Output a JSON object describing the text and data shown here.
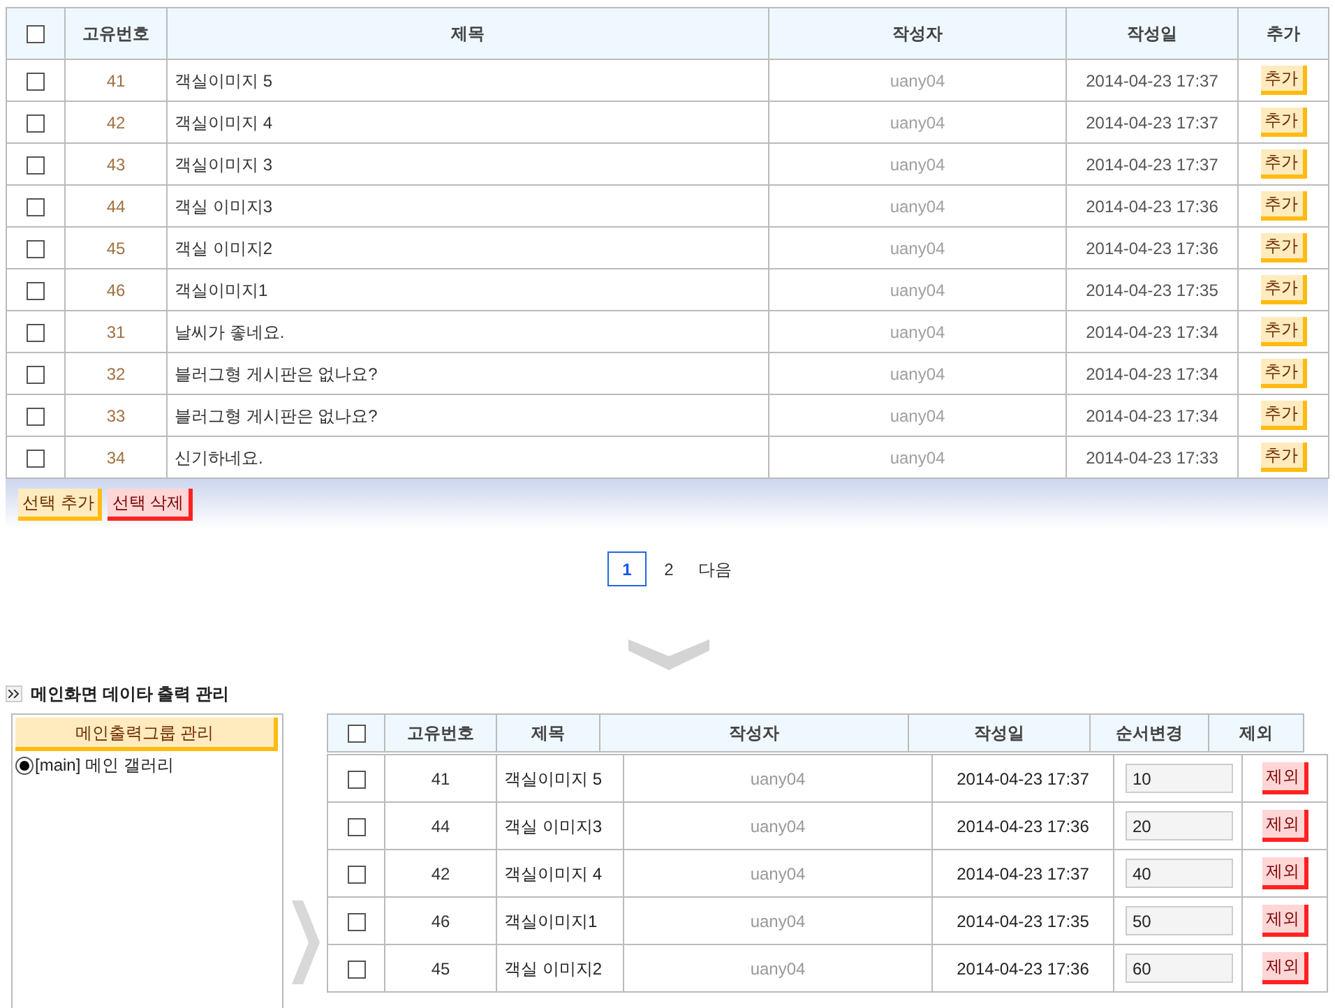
{
  "list_table": {
    "columns": [
      "고유번호",
      "제목",
      "작성자",
      "작성일",
      "추가"
    ],
    "header_checked": false,
    "rows": [
      {
        "checked": false,
        "id": "41",
        "title": "객실이미지 5",
        "author": "uany04",
        "date": "2014-04-23 17:37",
        "button": "추가"
      },
      {
        "checked": false,
        "id": "42",
        "title": "객실이미지 4",
        "author": "uany04",
        "date": "2014-04-23 17:37",
        "button": "추가"
      },
      {
        "checked": false,
        "id": "43",
        "title": "객실이미지 3",
        "author": "uany04",
        "date": "2014-04-23 17:37",
        "button": "추가"
      },
      {
        "checked": false,
        "id": "44",
        "title": "객실 이미지3",
        "author": "uany04",
        "date": "2014-04-23 17:36",
        "button": "추가"
      },
      {
        "checked": false,
        "id": "45",
        "title": "객실 이미지2",
        "author": "uany04",
        "date": "2014-04-23 17:36",
        "button": "추가"
      },
      {
        "checked": false,
        "id": "46",
        "title": "객실이미지1",
        "author": "uany04",
        "date": "2014-04-23 17:35",
        "button": "추가"
      },
      {
        "checked": false,
        "id": "31",
        "title": "날씨가 좋네요.",
        "author": "uany04",
        "date": "2014-04-23 17:34",
        "button": "추가"
      },
      {
        "checked": false,
        "id": "32",
        "title": "블러그형 게시판은 없나요?",
        "author": "uany04",
        "date": "2014-04-23 17:34",
        "button": "추가"
      },
      {
        "checked": false,
        "id": "33",
        "title": "블러그형 게시판은 없나요?",
        "author": "uany04",
        "date": "2014-04-23 17:34",
        "button": "추가"
      },
      {
        "checked": false,
        "id": "34",
        "title": "신기하네요.",
        "author": "uany04",
        "date": "2014-04-23 17:33",
        "button": "추가"
      }
    ],
    "actions": [
      {
        "label": "선택 추가",
        "kind": "add"
      },
      {
        "label": "선택 삭제",
        "kind": "delete"
      }
    ]
  },
  "pagination": [
    {
      "label": "1",
      "selected": true
    },
    {
      "label": "2",
      "selected": false
    },
    {
      "label": "다음",
      "selected": false
    }
  ],
  "section_title": "메인화면 데이타 출력 관리",
  "group_panel": {
    "button": "메인출력그룹 관리",
    "groups": [
      {
        "label": "[main] 메인 갤러리",
        "selected": true
      }
    ]
  },
  "output_table": {
    "columns": [
      "고유번호",
      "제목",
      "작성자",
      "작성일",
      "순서변경",
      "제외"
    ],
    "header_checked": false,
    "rows": [
      {
        "checked": false,
        "id": "41",
        "title": "객실이미지 5",
        "author": "uany04",
        "date": "2014-04-23 17:37",
        "order": "10",
        "button": "제외"
      },
      {
        "checked": false,
        "id": "44",
        "title": "객실 이미지3",
        "author": "uany04",
        "date": "2014-04-23 17:36",
        "order": "20",
        "button": "제외"
      },
      {
        "checked": false,
        "id": "42",
        "title": "객실이미지 4",
        "author": "uany04",
        "date": "2014-04-23 17:37",
        "order": "40",
        "button": "제외"
      },
      {
        "checked": false,
        "id": "46",
        "title": "객실이미지1",
        "author": "uany04",
        "date": "2014-04-23 17:35",
        "order": "50",
        "button": "제외"
      },
      {
        "checked": false,
        "id": "45",
        "title": "객실 이미지2",
        "author": "uany04",
        "date": "2014-04-23 17:36",
        "order": "60",
        "button": "제외"
      }
    ]
  }
}
